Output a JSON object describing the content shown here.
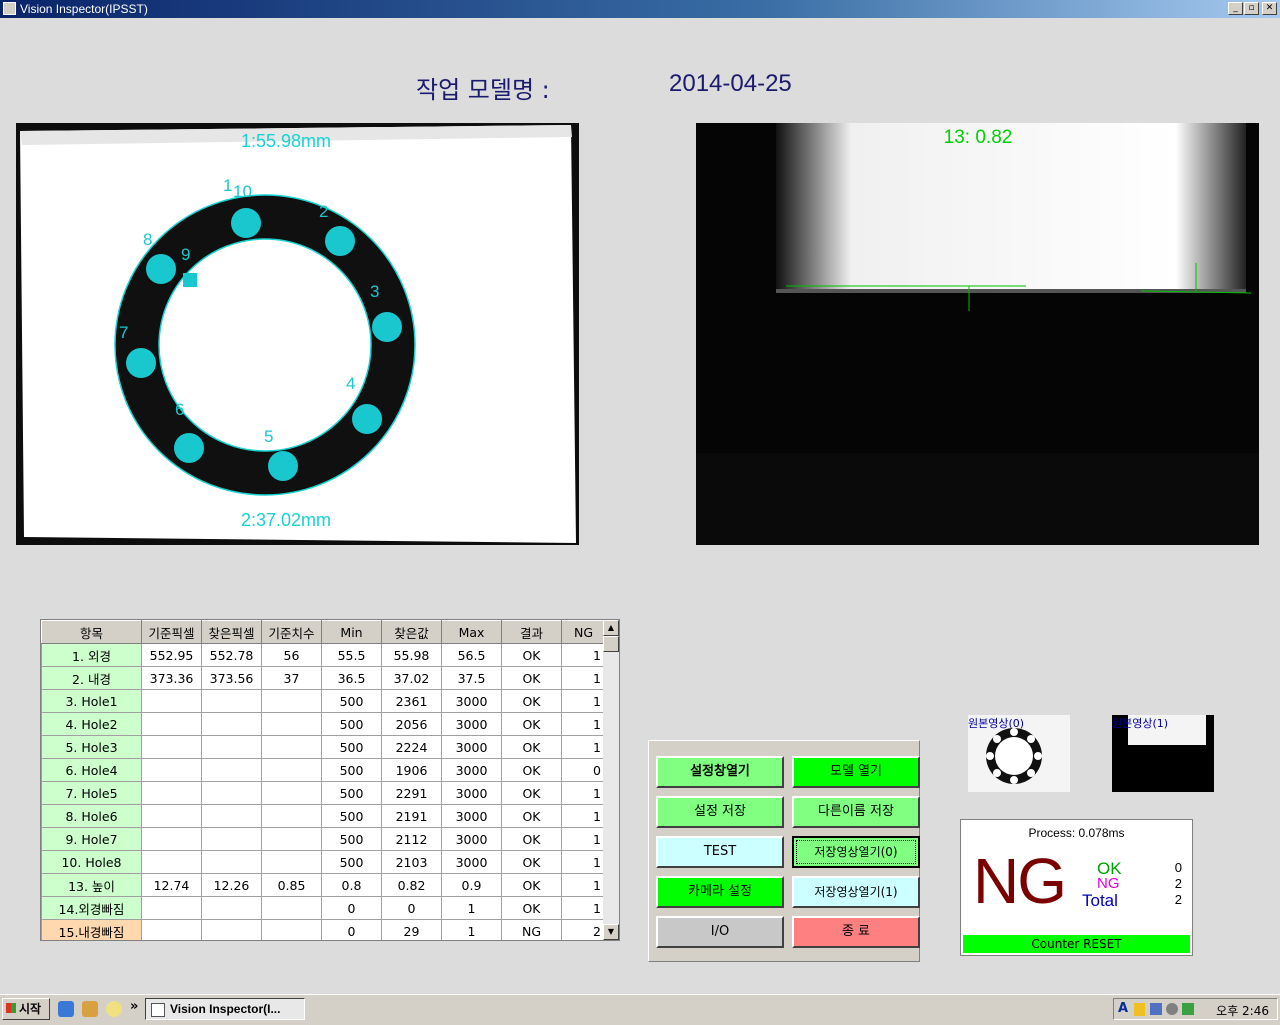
{
  "window": {
    "title": "Vision Inspector(IPSST)",
    "min": "_",
    "restore": "▫",
    "close": "✕"
  },
  "header": {
    "model_label": "작업 모델명 :",
    "date": "2014-04-25"
  },
  "camera1": {
    "measure_top": "1:55.98mm",
    "measure_bottom": "2:37.02mm",
    "hole_labels": [
      "1",
      "10",
      "2",
      "3",
      "4",
      "5",
      "6",
      "7",
      "8",
      "9"
    ]
  },
  "camera2": {
    "overlay": "13: 0.82"
  },
  "table": {
    "headers": [
      "항목",
      "기준픽셀",
      "찾은픽셀",
      "기준치수",
      "Min",
      "찾은값",
      "Max",
      "결과",
      "NG"
    ],
    "rows": [
      {
        "item": "1. 외경",
        "ref_px": "552.95",
        "found_px": "552.78",
        "ref_dim": "56",
        "min": "55.5",
        "found": "55.98",
        "max": "56.5",
        "result": "OK",
        "ng": "1"
      },
      {
        "item": "2. 내경",
        "ref_px": "373.36",
        "found_px": "373.56",
        "ref_dim": "37",
        "min": "36.5",
        "found": "37.02",
        "max": "37.5",
        "result": "OK",
        "ng": "1"
      },
      {
        "item": "3. Hole1",
        "ref_px": "",
        "found_px": "",
        "ref_dim": "",
        "min": "500",
        "found": "2361",
        "max": "3000",
        "result": "OK",
        "ng": "1"
      },
      {
        "item": "4. Hole2",
        "ref_px": "",
        "found_px": "",
        "ref_dim": "",
        "min": "500",
        "found": "2056",
        "max": "3000",
        "result": "OK",
        "ng": "1"
      },
      {
        "item": "5. Hole3",
        "ref_px": "",
        "found_px": "",
        "ref_dim": "",
        "min": "500",
        "found": "2224",
        "max": "3000",
        "result": "OK",
        "ng": "1"
      },
      {
        "item": "6. Hole4",
        "ref_px": "",
        "found_px": "",
        "ref_dim": "",
        "min": "500",
        "found": "1906",
        "max": "3000",
        "result": "OK",
        "ng": "0"
      },
      {
        "item": "7. Hole5",
        "ref_px": "",
        "found_px": "",
        "ref_dim": "",
        "min": "500",
        "found": "2291",
        "max": "3000",
        "result": "OK",
        "ng": "1"
      },
      {
        "item": "8. Hole6",
        "ref_px": "",
        "found_px": "",
        "ref_dim": "",
        "min": "500",
        "found": "2191",
        "max": "3000",
        "result": "OK",
        "ng": "1"
      },
      {
        "item": "9. Hole7",
        "ref_px": "",
        "found_px": "",
        "ref_dim": "",
        "min": "500",
        "found": "2112",
        "max": "3000",
        "result": "OK",
        "ng": "1"
      },
      {
        "item": "10.  Hole8",
        "ref_px": "",
        "found_px": "",
        "ref_dim": "",
        "min": "500",
        "found": "2103",
        "max": "3000",
        "result": "OK",
        "ng": "1"
      },
      {
        "item": "13. 높이",
        "ref_px": "12.74",
        "found_px": "12.26",
        "ref_dim": "0.85",
        "min": "0.8",
        "found": "0.82",
        "max": "0.9",
        "result": "OK",
        "ng": "1"
      },
      {
        "item": "14.외경빠짐",
        "ref_px": "",
        "found_px": "",
        "ref_dim": "",
        "min": "0",
        "found": "0",
        "max": "1",
        "result": "OK",
        "ng": "1"
      },
      {
        "item": "15.내경빠짐",
        "ref_px": "",
        "found_px": "",
        "ref_dim": "",
        "min": "0",
        "found": "29",
        "max": "1",
        "result": "NG",
        "ng": "2"
      }
    ]
  },
  "buttons": {
    "open_settings": "설정창열기",
    "open_model": "모델 열기",
    "save_settings": "설정 저장",
    "save_as": "다른이름 저장",
    "test": "TEST",
    "open_saved0": "저장영상열기(0)",
    "camera_settings": "카메라 설정",
    "open_saved1": "저장영상열기(1)",
    "io": "I/O",
    "exit": "종   료"
  },
  "thumbnails": {
    "t0": "원본영상(0)",
    "t1": "원본영상(1)"
  },
  "result": {
    "process": "Process: 0.078ms",
    "verdict": "NG",
    "ok_label": "OK",
    "ok_count": "0",
    "ng_label": "NG",
    "ng_count": "2",
    "total_label": "Total",
    "total_count": "2",
    "reset": "Counter RESET",
    "colors": {
      "ok": "#00a000",
      "ng": "#e000e0",
      "total": "#0000c0",
      "verdict": "#7a0000"
    }
  },
  "taskbar": {
    "start": "시작",
    "task": "Vision Inspector(I...",
    "chevron": "»",
    "clock": "오후 2:46",
    "tray_letter": "A"
  }
}
